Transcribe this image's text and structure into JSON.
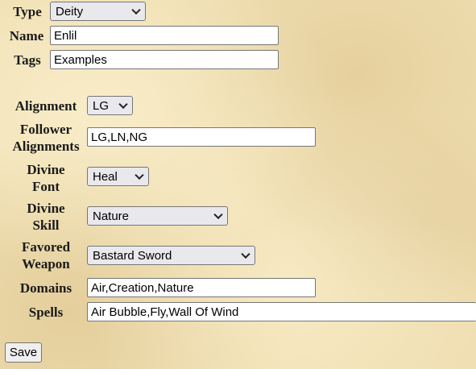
{
  "form": {
    "type": {
      "label": "Type",
      "value": "Deity"
    },
    "name": {
      "label": "Name",
      "value": "Enlil"
    },
    "tags": {
      "label": "Tags",
      "value": "Examples"
    },
    "alignment": {
      "label": "Alignment",
      "value": "LG"
    },
    "follower_alignments": {
      "label_line1": "Follower",
      "label_line2": "Alignments",
      "value": "LG,LN,NG"
    },
    "divine_font": {
      "label_line1": "Divine",
      "label_line2": "Font",
      "value": "Heal"
    },
    "divine_skill": {
      "label_line1": "Divine",
      "label_line2": "Skill",
      "value": "Nature"
    },
    "favored_weapon": {
      "label_line1": "Favored",
      "label_line2": "Weapon",
      "value": "Bastard Sword"
    },
    "domains": {
      "label": "Domains",
      "value": "Air,Creation,Nature"
    },
    "spells": {
      "label": "Spells",
      "value": "Air Bubble,Fly,Wall Of Wind"
    }
  },
  "save_button": {
    "label": "Save"
  }
}
